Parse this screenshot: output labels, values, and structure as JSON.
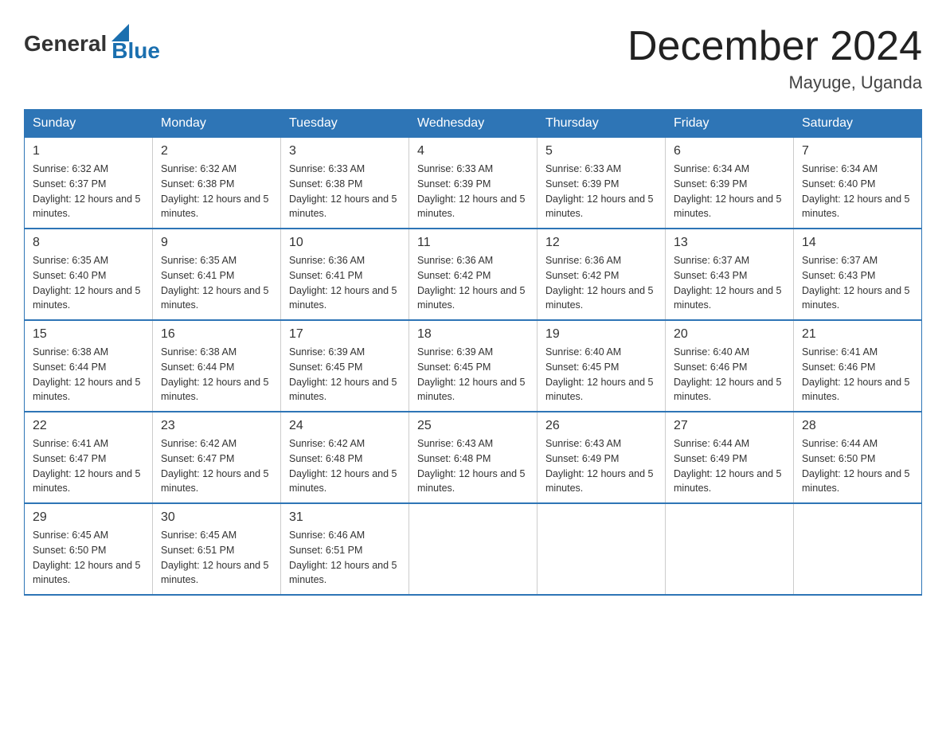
{
  "logo": {
    "general": "General",
    "blue": "Blue"
  },
  "title": "December 2024",
  "location": "Mayuge, Uganda",
  "days_of_week": [
    "Sunday",
    "Monday",
    "Tuesday",
    "Wednesday",
    "Thursday",
    "Friday",
    "Saturday"
  ],
  "weeks": [
    [
      {
        "day": "1",
        "sunrise": "6:32 AM",
        "sunset": "6:37 PM",
        "daylight": "12 hours and 5 minutes."
      },
      {
        "day": "2",
        "sunrise": "6:32 AM",
        "sunset": "6:38 PM",
        "daylight": "12 hours and 5 minutes."
      },
      {
        "day": "3",
        "sunrise": "6:33 AM",
        "sunset": "6:38 PM",
        "daylight": "12 hours and 5 minutes."
      },
      {
        "day": "4",
        "sunrise": "6:33 AM",
        "sunset": "6:39 PM",
        "daylight": "12 hours and 5 minutes."
      },
      {
        "day": "5",
        "sunrise": "6:33 AM",
        "sunset": "6:39 PM",
        "daylight": "12 hours and 5 minutes."
      },
      {
        "day": "6",
        "sunrise": "6:34 AM",
        "sunset": "6:39 PM",
        "daylight": "12 hours and 5 minutes."
      },
      {
        "day": "7",
        "sunrise": "6:34 AM",
        "sunset": "6:40 PM",
        "daylight": "12 hours and 5 minutes."
      }
    ],
    [
      {
        "day": "8",
        "sunrise": "6:35 AM",
        "sunset": "6:40 PM",
        "daylight": "12 hours and 5 minutes."
      },
      {
        "day": "9",
        "sunrise": "6:35 AM",
        "sunset": "6:41 PM",
        "daylight": "12 hours and 5 minutes."
      },
      {
        "day": "10",
        "sunrise": "6:36 AM",
        "sunset": "6:41 PM",
        "daylight": "12 hours and 5 minutes."
      },
      {
        "day": "11",
        "sunrise": "6:36 AM",
        "sunset": "6:42 PM",
        "daylight": "12 hours and 5 minutes."
      },
      {
        "day": "12",
        "sunrise": "6:36 AM",
        "sunset": "6:42 PM",
        "daylight": "12 hours and 5 minutes."
      },
      {
        "day": "13",
        "sunrise": "6:37 AM",
        "sunset": "6:43 PM",
        "daylight": "12 hours and 5 minutes."
      },
      {
        "day": "14",
        "sunrise": "6:37 AM",
        "sunset": "6:43 PM",
        "daylight": "12 hours and 5 minutes."
      }
    ],
    [
      {
        "day": "15",
        "sunrise": "6:38 AM",
        "sunset": "6:44 PM",
        "daylight": "12 hours and 5 minutes."
      },
      {
        "day": "16",
        "sunrise": "6:38 AM",
        "sunset": "6:44 PM",
        "daylight": "12 hours and 5 minutes."
      },
      {
        "day": "17",
        "sunrise": "6:39 AM",
        "sunset": "6:45 PM",
        "daylight": "12 hours and 5 minutes."
      },
      {
        "day": "18",
        "sunrise": "6:39 AM",
        "sunset": "6:45 PM",
        "daylight": "12 hours and 5 minutes."
      },
      {
        "day": "19",
        "sunrise": "6:40 AM",
        "sunset": "6:45 PM",
        "daylight": "12 hours and 5 minutes."
      },
      {
        "day": "20",
        "sunrise": "6:40 AM",
        "sunset": "6:46 PM",
        "daylight": "12 hours and 5 minutes."
      },
      {
        "day": "21",
        "sunrise": "6:41 AM",
        "sunset": "6:46 PM",
        "daylight": "12 hours and 5 minutes."
      }
    ],
    [
      {
        "day": "22",
        "sunrise": "6:41 AM",
        "sunset": "6:47 PM",
        "daylight": "12 hours and 5 minutes."
      },
      {
        "day": "23",
        "sunrise": "6:42 AM",
        "sunset": "6:47 PM",
        "daylight": "12 hours and 5 minutes."
      },
      {
        "day": "24",
        "sunrise": "6:42 AM",
        "sunset": "6:48 PM",
        "daylight": "12 hours and 5 minutes."
      },
      {
        "day": "25",
        "sunrise": "6:43 AM",
        "sunset": "6:48 PM",
        "daylight": "12 hours and 5 minutes."
      },
      {
        "day": "26",
        "sunrise": "6:43 AM",
        "sunset": "6:49 PM",
        "daylight": "12 hours and 5 minutes."
      },
      {
        "day": "27",
        "sunrise": "6:44 AM",
        "sunset": "6:49 PM",
        "daylight": "12 hours and 5 minutes."
      },
      {
        "day": "28",
        "sunrise": "6:44 AM",
        "sunset": "6:50 PM",
        "daylight": "12 hours and 5 minutes."
      }
    ],
    [
      {
        "day": "29",
        "sunrise": "6:45 AM",
        "sunset": "6:50 PM",
        "daylight": "12 hours and 5 minutes."
      },
      {
        "day": "30",
        "sunrise": "6:45 AM",
        "sunset": "6:51 PM",
        "daylight": "12 hours and 5 minutes."
      },
      {
        "day": "31",
        "sunrise": "6:46 AM",
        "sunset": "6:51 PM",
        "daylight": "12 hours and 5 minutes."
      },
      null,
      null,
      null,
      null
    ]
  ]
}
